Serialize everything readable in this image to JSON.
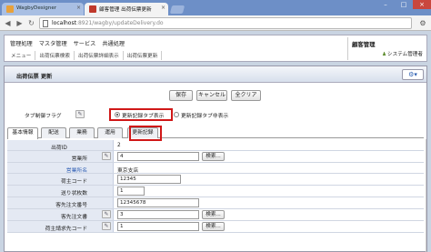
{
  "browser": {
    "tabs": [
      {
        "title": "WagbyDesigner"
      },
      {
        "title": "顧客管理 出荷伝票更新"
      }
    ],
    "url_prefix": "localhost",
    "url_rest": ":8921/wagby/updateDelivery.do"
  },
  "header": {
    "menu": [
      "管理処理",
      "マスタ管理",
      "サービス",
      "共通処理"
    ],
    "submenu": [
      "メニュー",
      "出荷伝票検索",
      "出荷伝票詳細表示",
      "出荷伝票更新"
    ],
    "system_title": "顧客管理",
    "user": "システム管理者"
  },
  "panel": {
    "title": "出荷伝票 更新",
    "buttons": {
      "save": "保存",
      "cancel": "キャンセル",
      "clear": "全クリア"
    },
    "tabflag": {
      "label": "タブ制御フラグ",
      "options": [
        "更新記録タブ表示",
        "更新記録タブ非表示"
      ]
    },
    "tabs": [
      "基本情報",
      "配送",
      "業務",
      "運用",
      "更新記録"
    ],
    "fields": {
      "id_label": "出荷ID",
      "id_value": "2",
      "shop_label": "営業所",
      "shop_value": "4",
      "shopname_label": "営業所名",
      "shopname_value": "東京支店",
      "customer_label": "荷主コード",
      "customer_value": "12345",
      "count_label": "送り状枚数",
      "count_value": "1",
      "order_label": "客先注文番号",
      "order_value": "12345678",
      "slip_label": "客先注文書",
      "slip_value": "3",
      "billing_label": "荷主請求先コード",
      "billing_value": "1"
    },
    "search_label": "検索..."
  }
}
